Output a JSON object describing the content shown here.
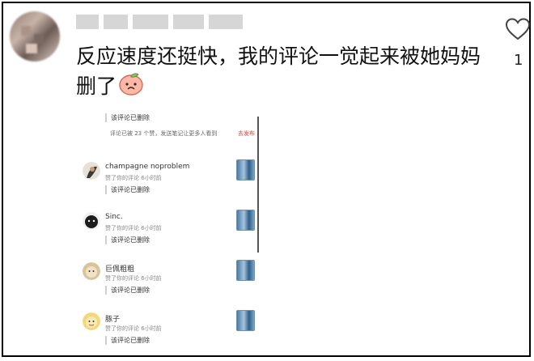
{
  "comment": {
    "text": "反应速度还挺快，我的评论一觉起来被她妈妈删了",
    "emoji": "peach-face-emoji",
    "like_count": "1"
  },
  "embedded": {
    "top_deleted": "该评论已删除",
    "notice": "评论已被 23 个赞，发送笔记让更多人看到",
    "notice_action": "去发布",
    "rows": [
      {
        "name": "champagne noproblem",
        "meta": "赞了你的评论   6小时前",
        "deleted": "该评论已删除"
      },
      {
        "name": "Sinc.",
        "meta": "赞了你的评论   6小时前",
        "deleted": "该评论已删除"
      },
      {
        "name": "巨佩粗粗",
        "meta": "赞了你的评论   6小时前",
        "deleted": "该评论已删除"
      },
      {
        "name": "豚子",
        "meta": "赞了你的评论   6小时前",
        "deleted": "该评论已删除"
      }
    ]
  },
  "colors": {
    "accent": "#d0413a",
    "text": "#111111",
    "border": "#000000"
  }
}
